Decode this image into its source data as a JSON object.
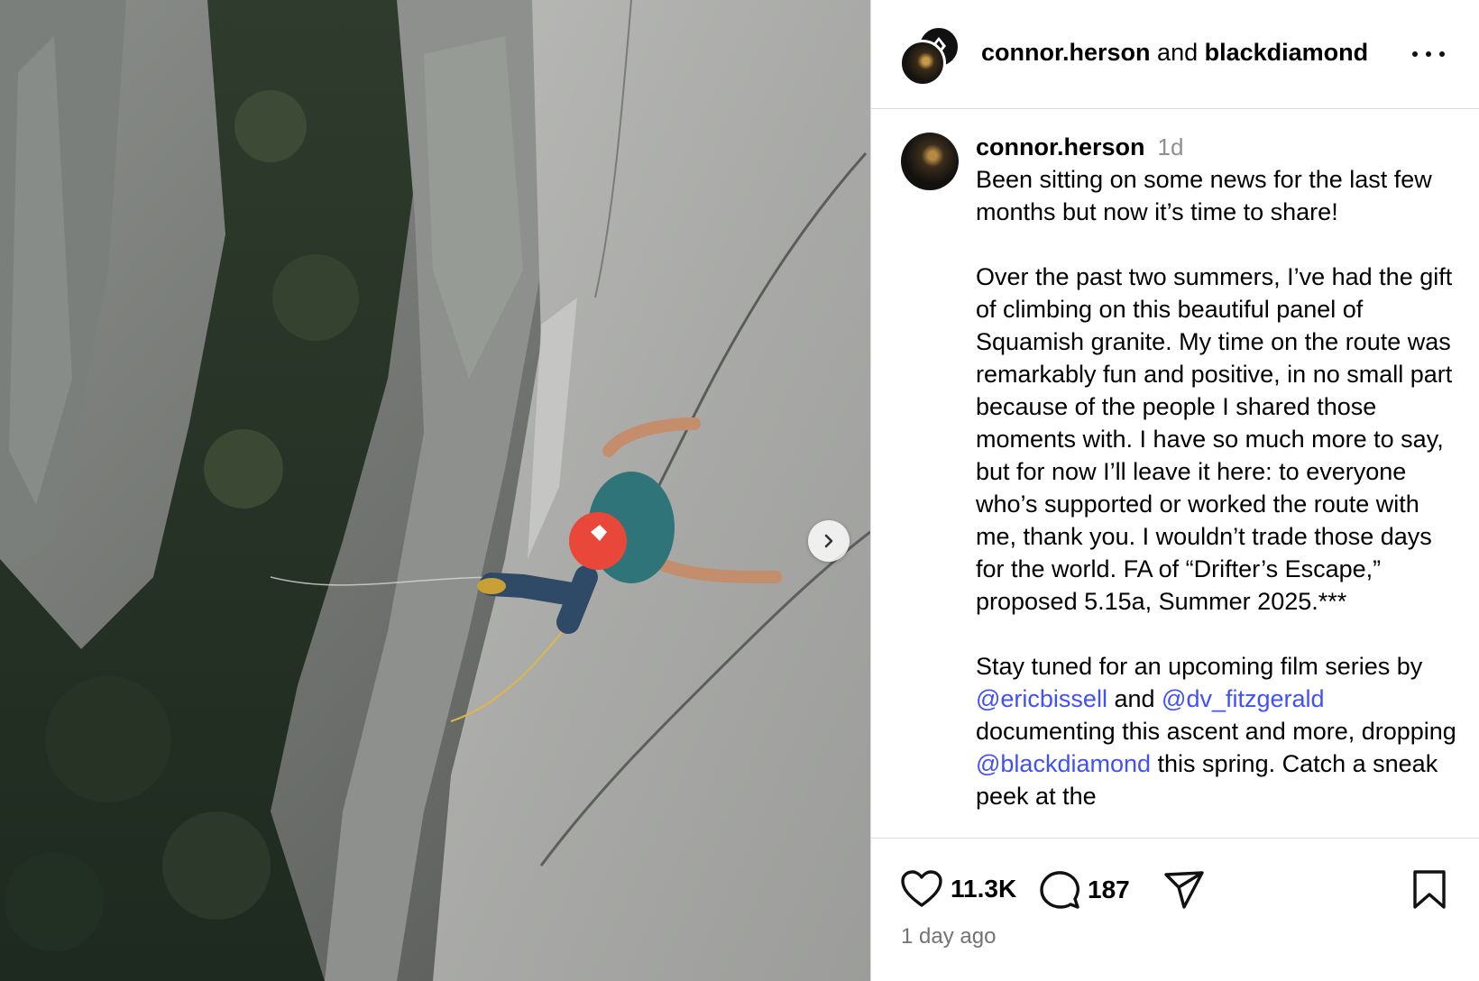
{
  "header": {
    "user1": "connor.herson",
    "joiner": "and",
    "user2": "blackdiamond",
    "more_label": "More options"
  },
  "caption": {
    "username": "connor.herson",
    "time": "1d",
    "p1": "Been sitting on some news for the last few months but now it’s time to share!",
    "p2": "Over the past two summers, I’ve had the gift of climbing on this beautiful panel of Squamish granite. My time on the route was remarkably fun and positive, in no small part because of the people I shared those moments with. I have so much more to say, but for now I’ll leave it here: to everyone who’s supported or worked the route with me, thank you. I wouldn’t trade those days for the world. FA of “Drifter’s Escape,” proposed 5.15a, Summer 2025.***",
    "p3_a": "Stay tuned for an upcoming film series by",
    "mention1": "@ericbissell",
    "p3_and": "and",
    "mention2": "@dv_fitzgerald",
    "p3_b": "documenting this ascent and more, dropping",
    "mention3": "@blackdiamond",
    "p3_c": "this spring. Catch a sneak peek at the"
  },
  "actions": {
    "likes": "11.3K",
    "comments": "187",
    "timestamp": "1 day ago"
  },
  "icons": {
    "like": "heart-icon",
    "comment": "speech-bubble-icon",
    "share": "paper-plane-icon",
    "save": "bookmark-icon",
    "next": "chevron-right-icon"
  }
}
